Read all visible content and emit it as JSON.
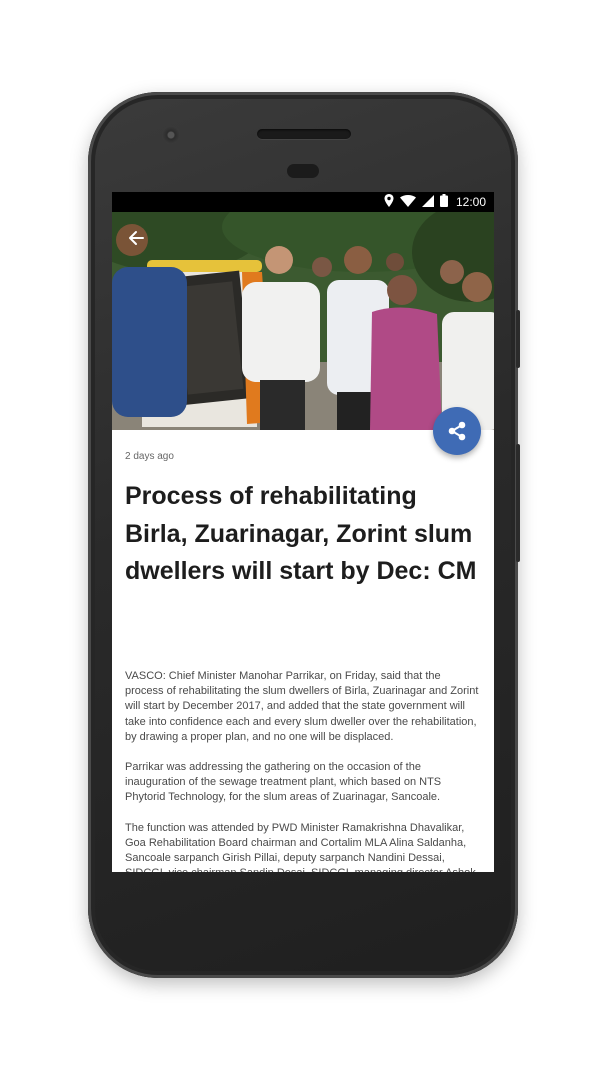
{
  "status_bar": {
    "time": "12:00",
    "icons": [
      "location-icon",
      "wifi-icon",
      "signal-icon",
      "battery-icon"
    ]
  },
  "article": {
    "time_ago": "2 days ago",
    "headline": "Process of rehabilitating Birla, Zuarinagar, Zorint slum dwellers will start by Dec: CM",
    "paragraphs": [
      "VASCO: Chief Minister Manohar Parrikar, on Friday, said that the process of rehabilitating the slum dwellers of Birla, Zuarinagar and Zorint will start by December 2017, and added that the state government will take into confidence each and every slum dweller over the rehabilitation, by drawing a proper plan, and no one will be displaced.",
      "Parrikar was addressing the gathering on the occasion of the inauguration of the sewage treatment plant, which based on NTS Phytorid Technology, for the slum areas of Zuarinagar,  Sancoale.",
      "The function was attended by PWD Minister Ramakrishna Dhavalikar, Goa Rehabilitation Board chairman and Cortalim MLA Alina Saldanha, Sancoale sarpanch Girish Pillai, deputy sarpanch Nandini Dessai, SIDCGL vice chairman Sandip Desai, SIDCGL managing director Ashok Tamhankar and others."
    ]
  },
  "colors": {
    "fab": "#3f6bb5",
    "status_bar": "#000000",
    "headline": "#1d1d1d",
    "body_text": "#4a4a4a"
  }
}
